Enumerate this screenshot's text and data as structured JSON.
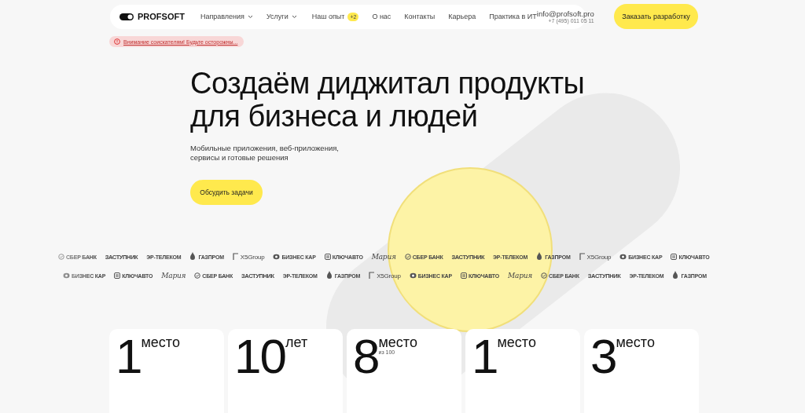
{
  "header": {
    "logo": "PROFSOFT",
    "nav": [
      {
        "label": "Направления",
        "dropdown": true
      },
      {
        "label": "Услуги",
        "dropdown": true
      },
      {
        "label": "Наш опыт",
        "badge": "+2",
        "dropdown": false
      },
      {
        "label": "О нас",
        "dropdown": false
      },
      {
        "label": "Контакты",
        "dropdown": false
      },
      {
        "label": "Карьера",
        "dropdown": false
      },
      {
        "label": "Практика в ИТ",
        "dropdown": false
      }
    ],
    "email": "info@profsoft.pro",
    "phone": "+7 (495) 011 05 11",
    "cta": "Заказать разработку"
  },
  "alert": "Внимание соискателям! Будьте осторожны...",
  "hero": {
    "title_lines": [
      "Создаём диджитал продукты",
      "для бизнеса и людей"
    ],
    "subtitle_lines": [
      "Мобильные приложения, веб-приложения,",
      "сервисы и готовые решения"
    ],
    "button": "Обсудить задачи"
  },
  "clients": [
    [
      {
        "kind": "sber",
        "name": "СБЕР БАНК"
      },
      {
        "kind": "condensed",
        "name": "ЗАСТУПНИК"
      },
      {
        "kind": "bold",
        "name": "ЭР-ТЕЛЕКОМ"
      },
      {
        "kind": "gazprom",
        "name": "ГАЗПРОМ"
      },
      {
        "kind": "x5",
        "name": "X5Group"
      },
      {
        "kind": "biznes",
        "name": "БИЗНЕС КАР"
      },
      {
        "kind": "klyuch",
        "name": "КЛЮЧАВТО"
      },
      {
        "kind": "script",
        "name": "Мария"
      },
      {
        "kind": "sber",
        "name": "СБЕР БАНК"
      },
      {
        "kind": "condensed",
        "name": "ЗАСТУПНИК"
      },
      {
        "kind": "bold",
        "name": "ЭР-ТЕЛЕКОМ"
      },
      {
        "kind": "gazprom",
        "name": "ГАЗПРОМ"
      },
      {
        "kind": "x5",
        "name": "X5Group"
      },
      {
        "kind": "biznes",
        "name": "БИЗНЕС КАР"
      },
      {
        "kind": "klyuch",
        "name": "КЛЮЧАВТО"
      }
    ],
    [
      {
        "kind": "biznes",
        "name": "БИЗНЕС КАР"
      },
      {
        "kind": "klyuch",
        "name": "КЛЮЧАВТО"
      },
      {
        "kind": "script",
        "name": "Мария"
      },
      {
        "kind": "sber",
        "name": "СБЕР БАНК"
      },
      {
        "kind": "condensed",
        "name": "ЗАСТУПНИК"
      },
      {
        "kind": "bold",
        "name": "ЭР-ТЕЛЕКОМ"
      },
      {
        "kind": "gazprom",
        "name": "ГАЗПРОМ"
      },
      {
        "kind": "x5",
        "name": "X5Group"
      },
      {
        "kind": "biznes",
        "name": "БИЗНЕС КАР"
      },
      {
        "kind": "klyuch",
        "name": "КЛЮЧАВТО"
      },
      {
        "kind": "script",
        "name": "Мария"
      },
      {
        "kind": "sber",
        "name": "СБЕР БАНК"
      },
      {
        "kind": "condensed",
        "name": "ЗАСТУПНИК"
      },
      {
        "kind": "bold",
        "name": "ЭР-ТЕЛЕКОМ"
      },
      {
        "kind": "gazprom",
        "name": "ГАЗПРОМ"
      }
    ]
  ],
  "stats": [
    {
      "number": "1",
      "unit": "место"
    },
    {
      "number": "10",
      "unit": "лет"
    },
    {
      "number": "8",
      "unit": "место",
      "note": "из 100"
    },
    {
      "number": "1",
      "unit": "место"
    },
    {
      "number": "3",
      "unit": "место"
    }
  ]
}
